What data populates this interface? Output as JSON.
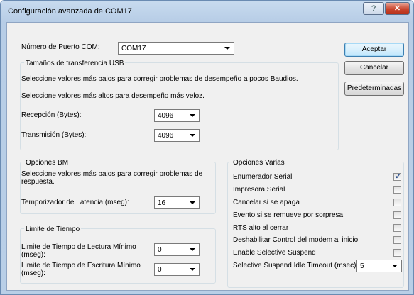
{
  "window": {
    "title": "Configuración avanzada de COM17",
    "help_glyph": "?",
    "close_glyph": "✕"
  },
  "port": {
    "label": "Número de Puerto COM:",
    "value": "COM17"
  },
  "buttons": {
    "accept": "Aceptar",
    "cancel": "Cancelar",
    "defaults": "Predeterminadas"
  },
  "usb": {
    "title": "Tamaños de transferencia USB",
    "hint_low": "Seleccione valores más bajos para corregir problemas de desempeño a pocos Baudios.",
    "hint_high": "Seleccione valores más altos para desempeño más veloz.",
    "receive_label": "Recepción (Bytes):",
    "receive_value": "4096",
    "transmit_label": "Transmisión (Bytes):",
    "transmit_value": "4096"
  },
  "bm": {
    "title": "Opciones BM",
    "hint_line1": "Seleccione valores más bajos para corregir problemas de",
    "hint_line2": "respuesta.",
    "latency_label": "Temporizador de Latencia (mseg):",
    "latency_value": "16"
  },
  "timeouts": {
    "title": "Limite de Tiempo",
    "read_label_1": "Limite de Tiempo de Lectura Mínimo",
    "read_label_2": "(mseg):",
    "read_value": "0",
    "write_label_1": "Limite de Tiempo de Escritura Mínimo",
    "write_label_2": "(mseg):",
    "write_value": "0"
  },
  "misc": {
    "title": "Opciones Varias",
    "options": [
      {
        "label": "Enumerador Serial",
        "checked": true
      },
      {
        "label": "Impresora Serial",
        "checked": false
      },
      {
        "label": "Cancelar si se apaga",
        "checked": false
      },
      {
        "label": "Evento si se remueve por sorpresa",
        "checked": false
      },
      {
        "label": "RTS alto al cerrar",
        "checked": false
      },
      {
        "label": "Deshabilitar Control del modem al inicio",
        "checked": false
      },
      {
        "label": "Enable Selective Suspend",
        "checked": false
      }
    ],
    "idle_label": "Selective Suspend Idle Timeout (msec):",
    "idle_value": "5"
  }
}
